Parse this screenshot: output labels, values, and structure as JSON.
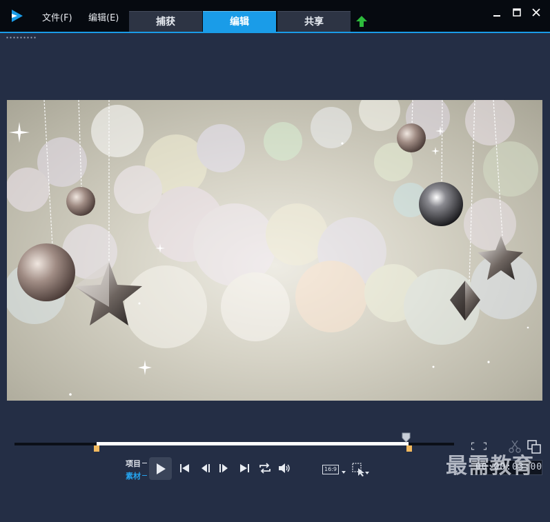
{
  "menu": {
    "file_label": "文件(F)",
    "edit_label": "编辑(E)"
  },
  "tabs": [
    {
      "label": "捕获"
    },
    {
      "label": "编辑"
    },
    {
      "label": "共享"
    }
  ],
  "colors": {
    "accent": "#1a9ce8",
    "titlebar": "#060a10",
    "panel": "#242e45",
    "marker": "#f2b95e",
    "upload": "#2dbb3c"
  },
  "preview": {
    "subject": "Christmas ornaments and bokeh background"
  },
  "timeline": {
    "mode_project": "项目",
    "mode_clip": "素材",
    "trim_in": 0.18,
    "trim_out": 0.89,
    "playhead": 0.89
  },
  "controls": {
    "play": "play-icon",
    "start": "go-to-start-icon",
    "prev_frame": "previous-frame-icon",
    "next_frame": "next-frame-icon",
    "end": "go-to-end-icon",
    "repeat": "repeat-icon",
    "volume": "volume-icon"
  },
  "aspect_ratio": "16:9",
  "timecode": "00:00:03:00",
  "watermark": "最需教育"
}
